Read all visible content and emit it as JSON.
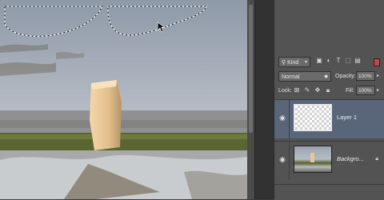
{
  "layers_panel": {
    "filter": {
      "kind_label": "Kind",
      "icons": [
        "image-filter-icon",
        "adjustment-filter-icon",
        "type-filter-icon",
        "shape-filter-icon",
        "smart-object-filter-icon"
      ]
    },
    "blend_mode": "Normal",
    "opacity_label": "Opacity:",
    "opacity_value": "100%",
    "lock_label": "Lock:",
    "lock_icons": [
      "lock-transparent-icon",
      "lock-image-icon",
      "lock-position-icon",
      "lock-all-icon"
    ],
    "fill_label": "Fill:",
    "fill_value": "100%",
    "layers": [
      {
        "name": "Layer 1",
        "selected": true,
        "visible": true
      },
      {
        "name": "Backgro...",
        "selected": false,
        "visible": true,
        "locked": true
      }
    ]
  },
  "colors": {
    "selected_layer": "#59667a",
    "panel_bg": "#535353"
  }
}
